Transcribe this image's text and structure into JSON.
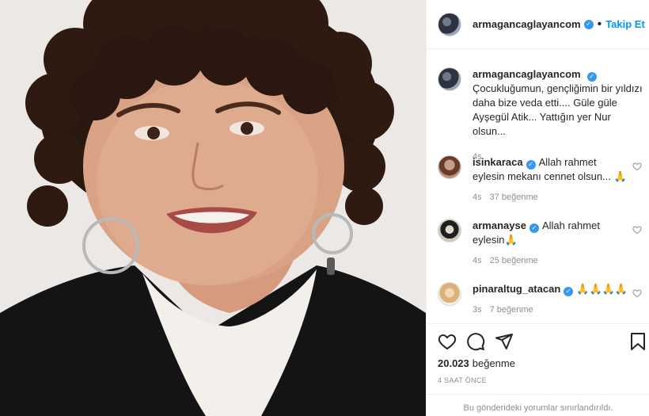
{
  "post": {
    "author": "armagancaglayancom",
    "follow_label": "Takip Et",
    "separator": "•",
    "caption": "Çocukluğumun, gençliğimin bir yıldızı daha bize veda etti.... Güle güle Ayşegül Atik... Yattığın yer Nur olsun...",
    "caption_time": "4s",
    "like_count": "20.023",
    "like_label": "beğenme",
    "post_time": "4 SAAT ÖNCE",
    "comments_limited": "Bu gönderideki yorumlar sınırlandırıldı."
  },
  "comments": [
    {
      "user": "isinkaraca",
      "text": "Allah rahmet eylesin mekanı cennet olsun... 🙏",
      "time": "4s",
      "likes": "37 beğenme"
    },
    {
      "user": "armanayse",
      "text": "Allah rahmet eylesin🙏",
      "time": "4s",
      "likes": "25 beğenme"
    },
    {
      "user": "pinaraltug_atacan",
      "text": "🙏🙏🙏🙏",
      "time": "3s",
      "likes": "7 beğenme"
    }
  ],
  "icons": {
    "verified": "verified-badge-icon",
    "like": "heart-icon",
    "comment": "comment-icon",
    "share": "share-icon",
    "save": "bookmark-icon"
  },
  "colors": {
    "accent": "#0095f6",
    "verified": "#3897f0",
    "muted": "#8e8e8e",
    "border": "#efefef"
  }
}
